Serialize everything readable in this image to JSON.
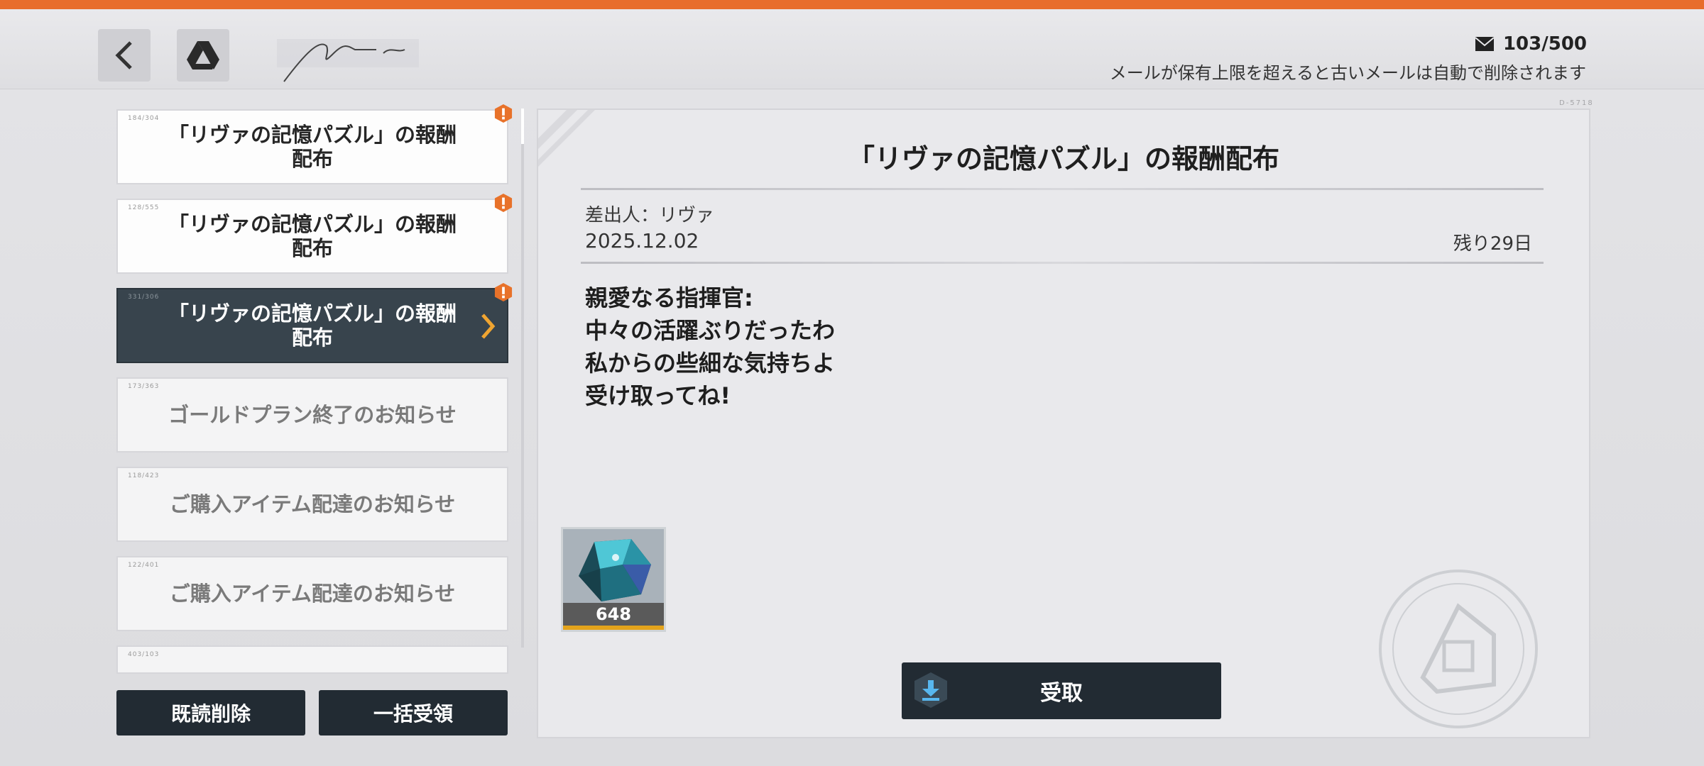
{
  "header": {
    "back_icon": "back-icon",
    "drive_icon": "drive-icon",
    "mail_icon": "mail-icon",
    "mail_count": "103/500",
    "mail_note": "メールが保有上限を超えると古いメールは自動で削除されます"
  },
  "mail_list": [
    {
      "title": "「リヴァの記憶パズル」の報酬\n配布",
      "unread": true,
      "selected": false,
      "read": false
    },
    {
      "title": "「リヴァの記憶パズル」の報酬\n配布",
      "unread": true,
      "selected": false,
      "read": false
    },
    {
      "title": "「リヴァの記憶パズル」の報酬\n配布",
      "unread": true,
      "selected": true,
      "read": false
    },
    {
      "title": "ゴールドプラン終了のお知らせ",
      "unread": false,
      "selected": false,
      "read": true
    },
    {
      "title": "ご購入アイテム配達のお知らせ",
      "unread": false,
      "selected": false,
      "read": true
    },
    {
      "title": "ご購入アイテム配達のお知らせ",
      "unread": false,
      "selected": false,
      "read": true
    }
  ],
  "footer": {
    "delete_read_label": "既読削除",
    "claim_all_label": "一括受領"
  },
  "detail": {
    "title": "「リヴァの記憶パズル」の報酬配布",
    "sender": "差出人：リヴァ",
    "date": "2025.12.02",
    "remaining": "残り29日",
    "body_lines": [
      "親愛なる指揮官:",
      "中々の活躍ぶりだったわ",
      "私からの些細な気持ちよ",
      "受け取ってね!"
    ],
    "reward": {
      "item_icon": "gem-icon",
      "quantity": "648"
    },
    "claim_label": "受取",
    "claim_icon": "download-icon"
  },
  "colors": {
    "accent_orange": "#e86d2c",
    "dark_button": "#222b33",
    "selected_item": "#38444d",
    "badge_orange": "#e8722a"
  }
}
